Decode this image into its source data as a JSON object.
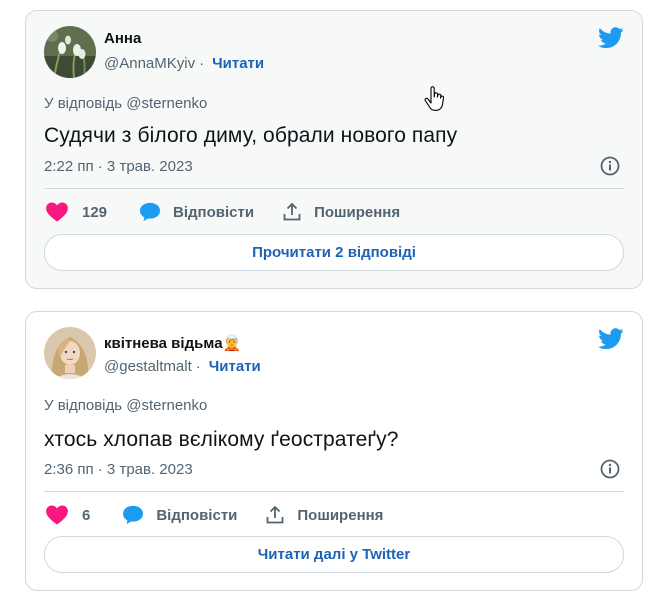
{
  "colors": {
    "accent": "#1d63b8",
    "like": "#f91880",
    "reply": "#1d9bf0",
    "muted": "#536471",
    "twitter": "#1d9bf0"
  },
  "tweets": [
    {
      "name": "Анна",
      "handle": "@AnnaMKyiv",
      "follow": "Читати",
      "reply_to": "У відповідь @sternenko",
      "text": "Судячи з білого диму, обрали нового папу",
      "time": "2:22 пп · 3 трав. 2023",
      "likes": "129",
      "reply_label": "Відповісти",
      "share_label": "Поширення",
      "button": "Прочитати 2 відповіді",
      "avatar_icon": "snowdrop-flower-photo"
    },
    {
      "name": "квітнева відьма🧝",
      "handle": "@gestaltmalt",
      "follow": "Читати",
      "reply_to": "У відповідь @sternenko",
      "text": "хтось хлопав вєлікому ґеостратеґу?",
      "time": "2:36 пп · 3 трав. 2023",
      "likes": "6",
      "reply_label": "Відповісти",
      "share_label": "Поширення",
      "button": "Читати далі у Twitter",
      "avatar_icon": "woman-portrait-photo"
    }
  ]
}
